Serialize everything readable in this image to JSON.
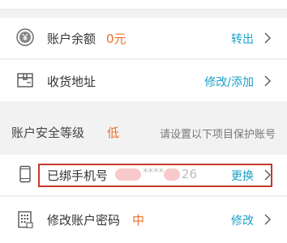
{
  "balance": {
    "label": "账户余额",
    "value": "0元",
    "action": "转出",
    "icon": "yen-coin-icon"
  },
  "address": {
    "label": "收货地址",
    "action": "修改/添加",
    "icon": "package-box-icon"
  },
  "security": {
    "label": "账户安全等级",
    "level": "低",
    "hint": "请设置以下项目保护账号"
  },
  "phone": {
    "label": "已绑手机号",
    "masked_number_visible": "****",
    "number_suffix": "26",
    "action": "更换",
    "icon": "mobile-phone-icon",
    "highlight_color": "#c9372c"
  },
  "password": {
    "label": "修改账户密码",
    "strength": "中",
    "action": "修改",
    "icon": "keypad-lock-icon"
  },
  "colors": {
    "accent_blue": "#1aa1c8",
    "accent_orange": "#e8702a"
  }
}
